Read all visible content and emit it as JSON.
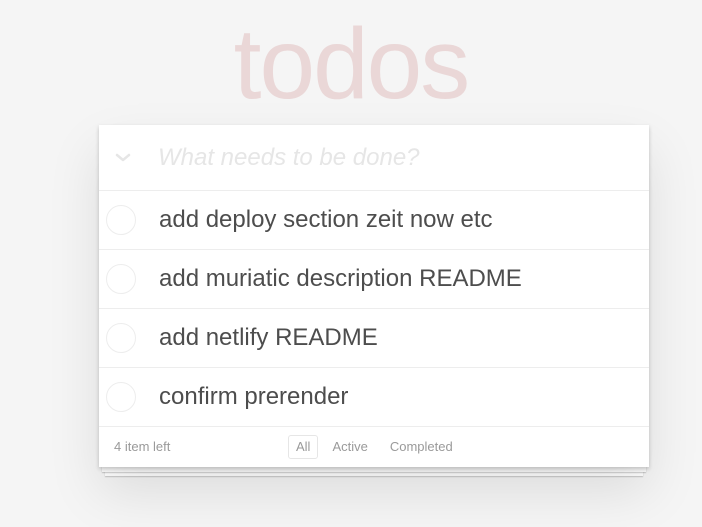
{
  "app": {
    "title": "todos"
  },
  "new_todo": {
    "placeholder": "What needs to be done?",
    "value": ""
  },
  "icons": {
    "toggle_all": "chevron-down-icon"
  },
  "todos": [
    {
      "label": "add deploy section zeit now etc",
      "completed": false
    },
    {
      "label": "add muriatic description README",
      "completed": false
    },
    {
      "label": "add netlify README",
      "completed": false
    },
    {
      "label": "confirm prerender",
      "completed": false
    }
  ],
  "footer": {
    "count_text": "4 item left",
    "filters": [
      {
        "label": "All",
        "selected": true
      },
      {
        "label": "Active",
        "selected": false
      },
      {
        "label": "Completed",
        "selected": false
      }
    ]
  },
  "colors": {
    "title": "#ead7d7",
    "background": "#f5f5f5",
    "text": "#4d4d4d",
    "muted": "#9a9a9a"
  }
}
